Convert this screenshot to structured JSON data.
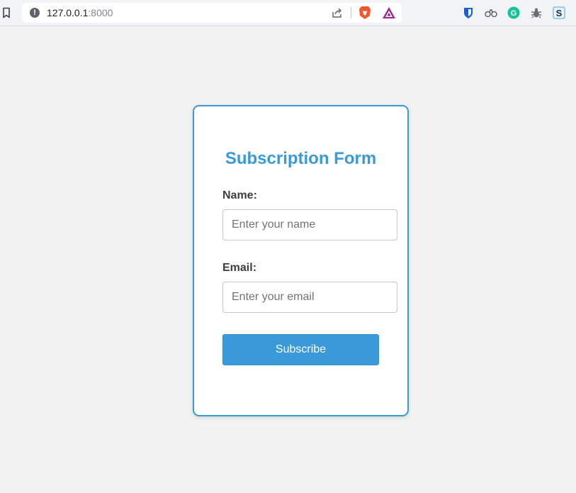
{
  "browser": {
    "url_host": "127.0.0.1",
    "url_port": ":8000",
    "icons": [
      "bookmark-icon",
      "info-icon",
      "share-icon",
      "brave-shields-icon",
      "brave-rewards-icon",
      "bitwarden-icon",
      "binoculars-icon",
      "grammarly-icon",
      "bug-icon",
      "s-extension-icon"
    ],
    "extension_s_letter": "S",
    "grammarly_letter": "G"
  },
  "form": {
    "title": "Subscription Form",
    "name_label": "Name:",
    "name_placeholder": "Enter your name",
    "name_value": "",
    "email_label": "Email:",
    "email_placeholder": "Enter your email",
    "email_value": "",
    "submit_label": "Subscribe"
  },
  "colors": {
    "accent": "#3a9ad9",
    "background": "#f2f2f2",
    "card": "#ffffff",
    "label": "#3d3d3d"
  }
}
